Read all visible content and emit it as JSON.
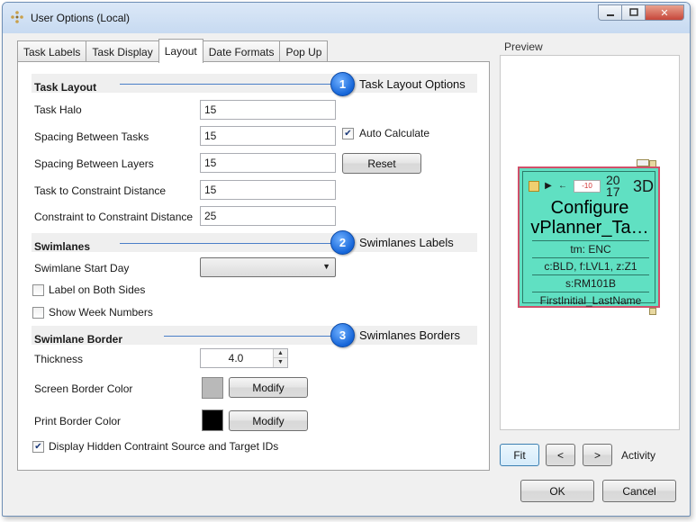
{
  "window": {
    "title": "User Options (Local)",
    "close_label": "✕"
  },
  "tabs": [
    {
      "label": "Task Labels",
      "active": false
    },
    {
      "label": "Task Display",
      "active": false
    },
    {
      "label": "Layout",
      "active": true
    },
    {
      "label": "Date Formats",
      "active": false
    },
    {
      "label": "Pop Up",
      "active": false
    }
  ],
  "task_layout": {
    "title": "Task Layout",
    "callout_number": "1",
    "callout_text": "Task Layout Options",
    "task_halo_label": "Task Halo",
    "task_halo_value": "15",
    "spacing_tasks_label": "Spacing Between Tasks",
    "spacing_tasks_value": "15",
    "auto_calculate_label": "Auto Calculate",
    "spacing_layers_label": "Spacing Between Layers",
    "spacing_layers_value": "15",
    "reset_label": "Reset",
    "task_constraint_label": "Task to Constraint Distance",
    "task_constraint_value": "15",
    "constraint_constraint_label": "Constraint to Constraint Distance",
    "constraint_constraint_value": "25"
  },
  "swimlanes": {
    "title": "Swimlanes",
    "callout_number": "2",
    "callout_text": "Swimlanes Labels",
    "start_day_label": "Swimlane Start Day",
    "start_day_value": "",
    "label_both_sides_label": "Label on Both Sides",
    "show_week_numbers_label": "Show Week Numbers"
  },
  "swimlane_border": {
    "title": "Swimlane Border",
    "callout_number": "3",
    "callout_text": "Swimlanes Borders",
    "thickness_label": "Thickness",
    "thickness_value": "4.0",
    "screen_color_label": "Screen Border Color",
    "screen_color": "#b9b9b9",
    "print_color_label": "Print Border Color",
    "print_color": "#000000",
    "modify_label": "Modify",
    "display_hidden_label": "Display Hidden Contraint Source and Target IDs"
  },
  "preview": {
    "label": "Preview",
    "card": {
      "offset": "-10",
      "num_top": "20",
      "num_bottom": "17",
      "duration": "3D",
      "title_line1": "Configure",
      "title_line2": "vPlanner_Ta…",
      "tm": "tm: ENC",
      "location": "c:BLD, f:LVL1, z:Z1",
      "space": "s:RM101B",
      "person": "FirstInitial_LastName",
      "fill_color": "#60e0c2",
      "border_color": "#d0506a"
    },
    "fit_label": "Fit",
    "prev_label": "<",
    "next_label": ">",
    "mode_label": "Activity"
  },
  "footer": {
    "ok_label": "OK",
    "cancel_label": "Cancel"
  },
  "colors": {
    "accent": "#1565d8",
    "callout_line": "#4a7fc8"
  }
}
